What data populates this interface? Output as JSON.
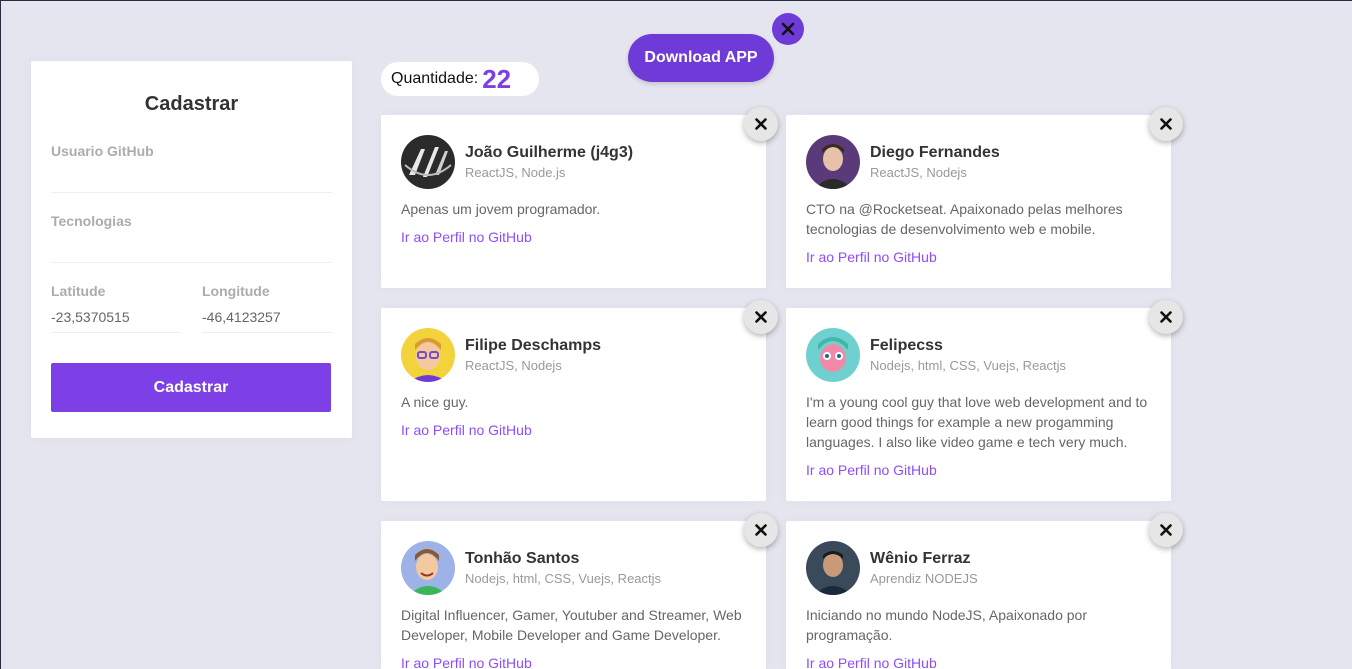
{
  "banner": {
    "download_label": "Download APP"
  },
  "form": {
    "title": "Cadastrar",
    "github_user": {
      "label": "Usuario GitHub",
      "value": ""
    },
    "techs": {
      "label": "Tecnologias",
      "value": ""
    },
    "latitude": {
      "label": "Latitude",
      "value": "-23,5370515"
    },
    "longitude": {
      "label": "Longitude",
      "value": "-46,4123257"
    },
    "submit_label": "Cadastrar"
  },
  "counter": {
    "label": "Quantidade:",
    "value": "22"
  },
  "devs": [
    {
      "name": "João Guilherme (j4g3)",
      "techs": "ReactJS, Node.js",
      "bio": "Apenas um jovem programador.",
      "link": "Ir ao Perfil no GitHub",
      "avatar_color": "#2b2b2b"
    },
    {
      "name": "Diego Fernandes",
      "techs": "ReactJS, Nodejs",
      "bio": "CTO na @Rocketseat. Apaixonado pelas melhores tecnologias de desenvolvimento web e mobile.",
      "link": "Ir ao Perfil no GitHub",
      "avatar_color": "#5a3a78"
    },
    {
      "name": "Filipe Deschamps",
      "techs": "ReactJS, Nodejs",
      "bio": "A nice guy.",
      "link": "Ir ao Perfil no GitHub",
      "avatar_color": "#f2d33c"
    },
    {
      "name": "Felipecss",
      "techs": "Nodejs, html, CSS, Vuejs, Reactjs",
      "bio": "I'm a young cool guy that love web development and to learn good things for example a new progamming languages. I also like video game e tech very much.",
      "link": "Ir ao Perfil no GitHub",
      "avatar_color": "#6fd0d0"
    },
    {
      "name": "Tonhão Santos",
      "techs": "Nodejs, html, CSS, Vuejs, Reactjs",
      "bio": "Digital Influencer, Gamer, Youtuber and Streamer, Web Developer, Mobile Developer and Game Developer.",
      "link": "Ir ao Perfil no GitHub",
      "avatar_color": "#9db3e8"
    },
    {
      "name": "Wênio Ferraz",
      "techs": "Aprendiz NODEJS",
      "bio": "Iniciando no mundo NodeJS, Apaixonado por programação.",
      "link": "Ir ao Perfil no GitHub",
      "avatar_color": "#3a4a5a"
    }
  ]
}
